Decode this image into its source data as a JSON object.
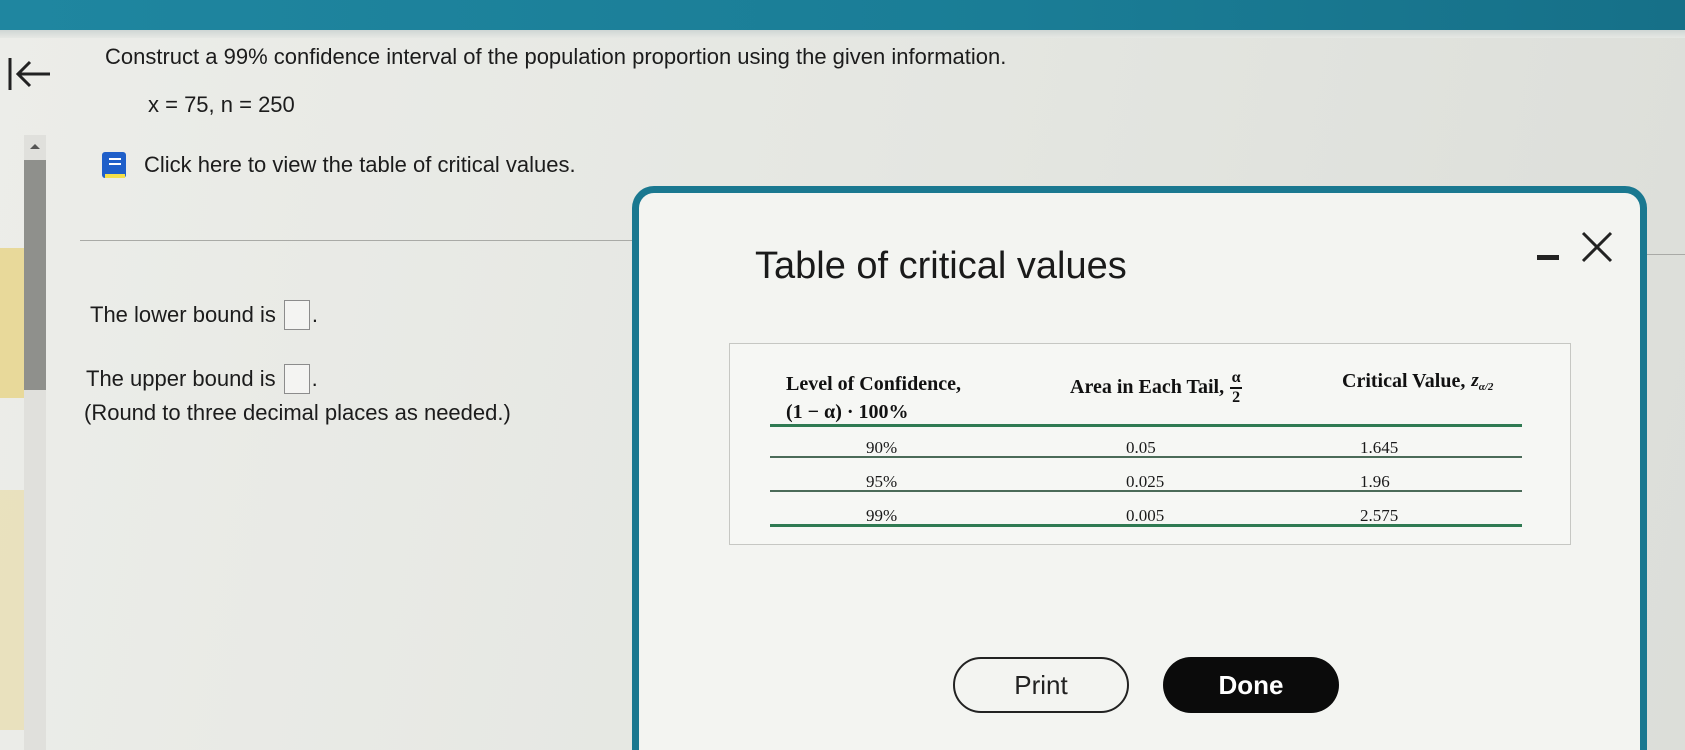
{
  "question": {
    "prompt": "Construct a 99% confidence interval of the population proportion using the given information.",
    "given": "x = 75, n = 250",
    "reference_link": "Click here to view the table of critical values."
  },
  "answers": {
    "lower_label": "The lower bound is",
    "upper_label": "The upper bound is",
    "period": ".",
    "rounding_note": "(Round to three decimal places as needed.)"
  },
  "modal": {
    "title": "Table of critical values",
    "table": {
      "headers": {
        "confidence_line1": "Level of Confidence,",
        "confidence_line2": "(1 − α) · 100%",
        "tail": "Area in Each Tail,",
        "tail_frac_num": "α",
        "tail_frac_den": "2",
        "critical": "Critical Value,",
        "critical_symbol": "z",
        "critical_sub": "α/2"
      },
      "rows": [
        {
          "confidence": "90%",
          "tail": "0.05",
          "critical": "1.645"
        },
        {
          "confidence": "95%",
          "tail": "0.025",
          "critical": "1.96"
        },
        {
          "confidence": "99%",
          "tail": "0.005",
          "critical": "2.575"
        }
      ]
    },
    "print_label": "Print",
    "done_label": "Done"
  },
  "colors": {
    "accent": "#1a7890",
    "table_rule": "#2f7a52",
    "done_button": "#0b0b0b"
  },
  "icons": [
    "back-to-start-icon",
    "book-icon",
    "minimize-icon",
    "close-icon",
    "scroll-up-icon"
  ]
}
